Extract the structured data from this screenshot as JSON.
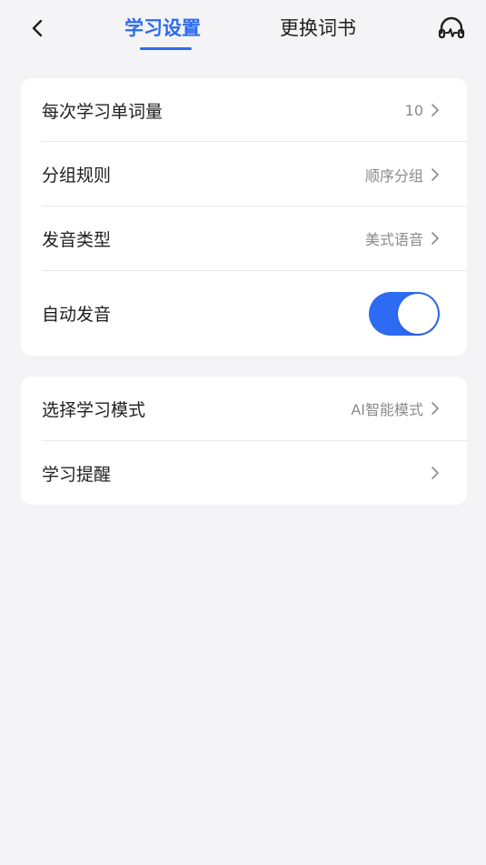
{
  "header": {
    "tabs": [
      {
        "label": "学习设置",
        "active": true
      },
      {
        "label": "更换词书",
        "active": false
      }
    ],
    "back_icon": "chevron-left-icon",
    "right_icon": "headset-icon"
  },
  "settings_group_1": {
    "words_per_session": {
      "label": "每次学习单词量",
      "value": "10"
    },
    "grouping_rule": {
      "label": "分组规则",
      "value": "顺序分组"
    },
    "pronunciation_type": {
      "label": "发音类型",
      "value": "美式语音"
    },
    "auto_pronounce": {
      "label": "自动发音",
      "enabled": true
    }
  },
  "settings_group_2": {
    "study_mode": {
      "label": "选择学习模式",
      "value": "AI智能模式"
    },
    "study_reminder": {
      "label": "学习提醒",
      "value": ""
    }
  },
  "colors": {
    "accent": "#2c6bf2",
    "background": "#f4f4f6",
    "card": "#ffffff",
    "secondary_text": "#8b8b8f"
  }
}
